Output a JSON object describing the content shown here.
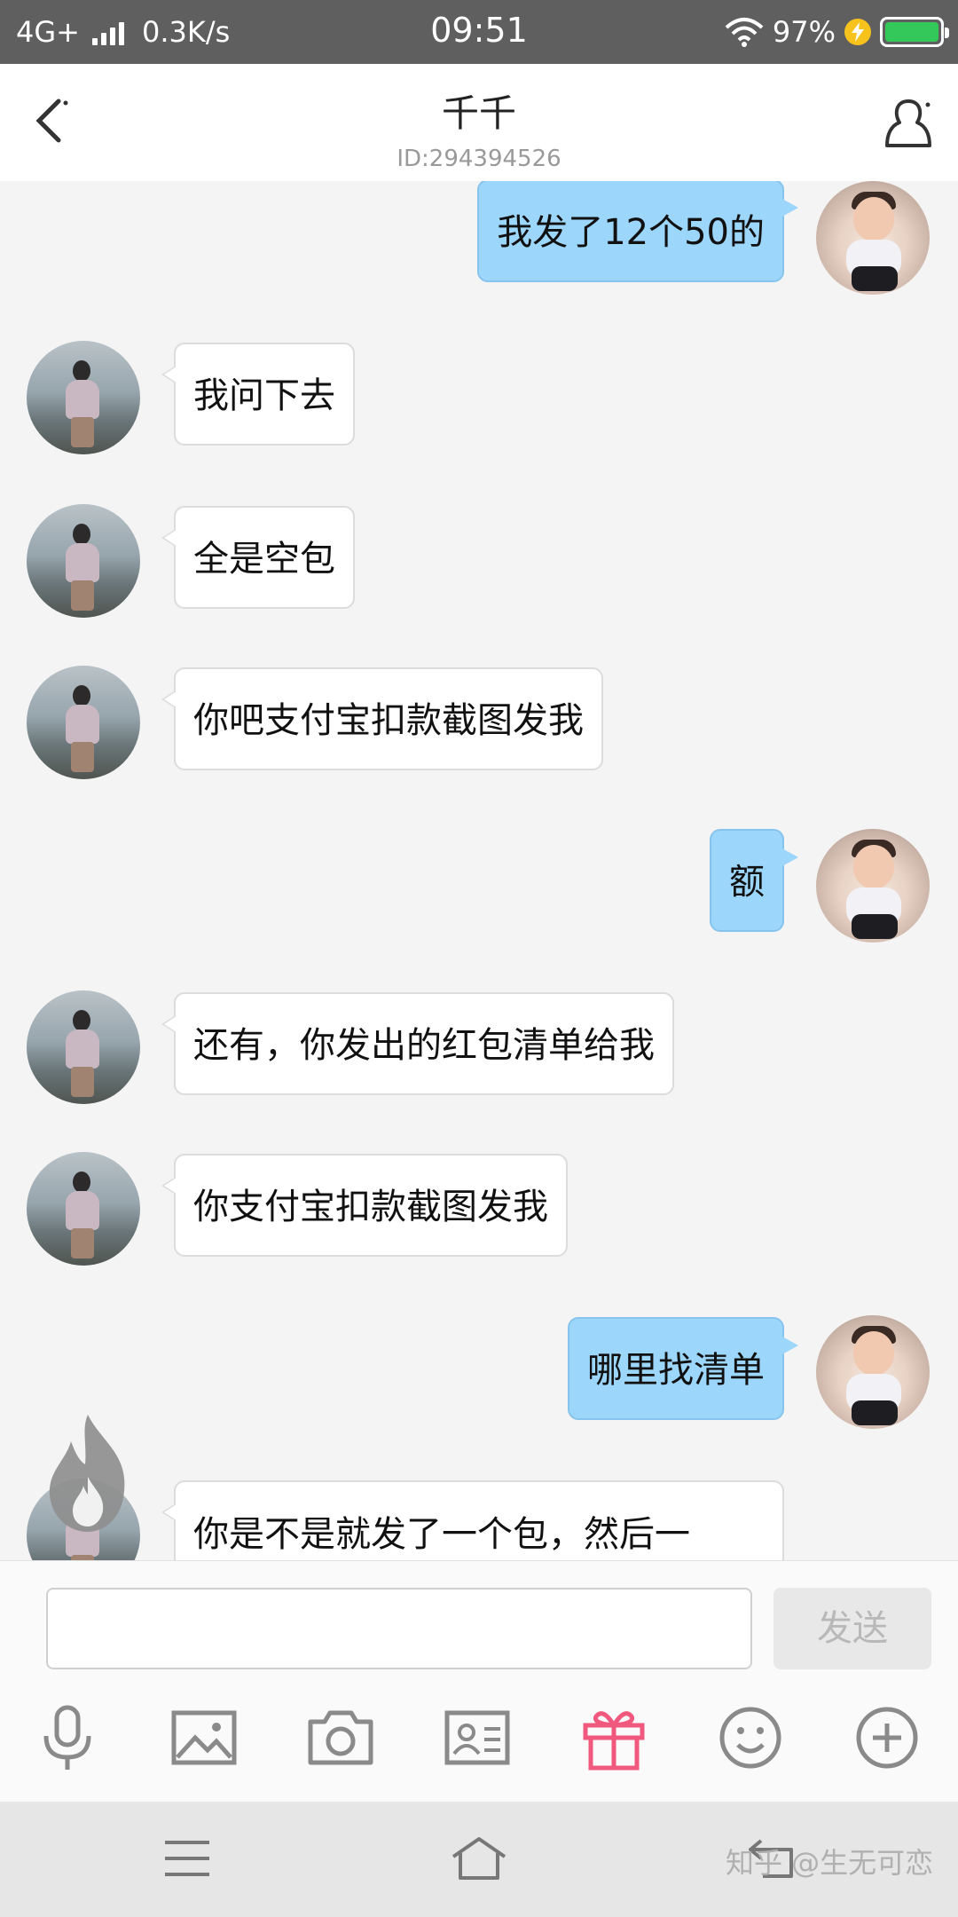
{
  "status_bar": {
    "network": "4G+",
    "speed": "0.3K/s",
    "time": "09:51",
    "battery": "97%"
  },
  "header": {
    "title": "千千",
    "subtitle": "ID:294394526"
  },
  "messages": [
    {
      "from": "me",
      "text": "我发了12个50的"
    },
    {
      "from": "her",
      "text": "我问下去"
    },
    {
      "from": "her",
      "text": "全是空包"
    },
    {
      "from": "her",
      "text": "你吧支付宝扣款截图发我"
    },
    {
      "from": "me",
      "text": "额"
    },
    {
      "from": "her",
      "text": "还有，你发出的红包清单给我"
    },
    {
      "from": "her",
      "text": "你支付宝扣款截图发我"
    },
    {
      "from": "me",
      "text": "哪里找清单"
    },
    {
      "from": "her",
      "text": "你是不是就发了一个包，然后一"
    }
  ],
  "input": {
    "send_label": "发送"
  },
  "toolbar": {
    "icons": [
      "microphone-icon",
      "image-icon",
      "camera-icon",
      "contact-card-icon",
      "gift-icon",
      "emoji-icon",
      "plus-icon"
    ],
    "gift_color": "#f0587e"
  },
  "watermark": "知乎 @生无可恋",
  "colors": {
    "my_bubble": "#9dd6fb",
    "her_bubble": "#ffffff",
    "status_bar": "#5f5f5f"
  }
}
